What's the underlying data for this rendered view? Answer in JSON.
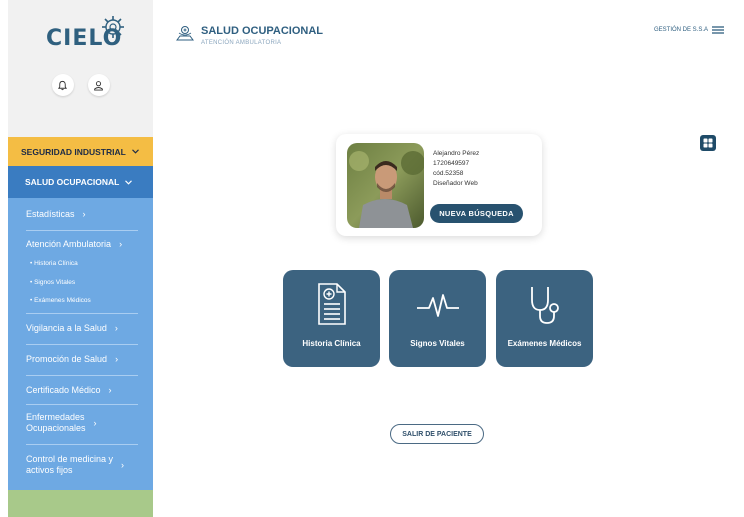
{
  "logo": {
    "text": "CIELO"
  },
  "sidebar": {
    "section_yellow": "SEGURIDAD INDUSTRIAL",
    "section_blue": "SALUD OCUPACIONAL",
    "items": [
      {
        "label": "Estadísticas"
      },
      {
        "label": "Atención Ambulatoria"
      },
      {
        "label": "Vigilancia a la Salud"
      },
      {
        "label": "Promoción de Salud"
      },
      {
        "label": "Certificado Médico"
      },
      {
        "label_line1": "Enfermedades",
        "label_line2": "Ocupacionales"
      },
      {
        "label_line1": "Control de medicina y",
        "label_line2": "activos fijos"
      }
    ],
    "subitems": [
      "• Historia Clínica",
      "• Signos Vitales",
      "• Exámenes Médicos"
    ]
  },
  "header": {
    "title": "SALUD OCUPACIONAL",
    "subtitle": "ATENCIÓN AMBULATORIA",
    "gestion": "GESTIÓN DE S.S.A"
  },
  "patient": {
    "name": "Alejandro Pérez",
    "id": "1720649597",
    "code": "cód.52358",
    "role": "Diseñador Web",
    "search_button": "NUEVA BÚSQUEDA"
  },
  "tiles": [
    {
      "label": "Historia Clínica",
      "icon": "clipboard-plus-icon"
    },
    {
      "label": "Signos Vitales",
      "icon": "heartbeat-icon"
    },
    {
      "label": "Exámenes Médicos",
      "icon": "stethoscope-icon"
    }
  ],
  "exit_button": "SALIR DE PACIENTE",
  "colors": {
    "primary": "#2f5f80",
    "tile": "#3c6380",
    "nav_yellow": "#f4bd44",
    "nav_blue": "#3a7cc1",
    "nav_list": "#6ea9e3"
  }
}
